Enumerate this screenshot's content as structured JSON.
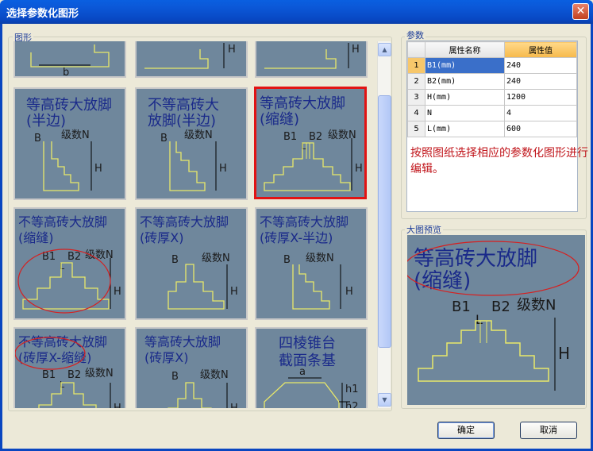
{
  "window": {
    "title": "选择参数化图形",
    "close_glyph": "✕"
  },
  "groups": {
    "shapes": "图形",
    "params": "参数",
    "preview": "大图预览"
  },
  "thumbnails": [
    {
      "line1": "",
      "line2": "",
      "labels": [
        "b"
      ]
    },
    {
      "line1": "",
      "line2": "",
      "labels": [
        "H"
      ]
    },
    {
      "line1": "",
      "line2": "",
      "labels": [
        "H"
      ]
    },
    {
      "line1": "等高砖大放脚",
      "line2": "(半边)",
      "labels": [
        "B",
        "级数N",
        "H"
      ]
    },
    {
      "line1": "不等高砖大",
      "line2": "放脚(半边)",
      "labels": [
        "B",
        "级数N",
        "H"
      ]
    },
    {
      "line1": "等高砖大放脚",
      "line2": "(缩缝)",
      "labels": [
        "B1",
        "B2",
        "级数N",
        "L",
        "H"
      ]
    },
    {
      "line1": "不等高砖大放脚",
      "line2": "(缩缝)",
      "labels": [
        "B1",
        "B2",
        "级数N",
        "L",
        "H"
      ]
    },
    {
      "line1": "不等高砖大放脚",
      "line2": "(砖厚X)",
      "labels": [
        "B",
        "级数N",
        "H"
      ]
    },
    {
      "line1": "不等高砖大放脚",
      "line2": "(砖厚X-半边)",
      "labels": [
        "B",
        "级数N",
        "H"
      ]
    },
    {
      "line1": "不等高砖大放脚",
      "line2": "(砖厚X-缩缝)",
      "labels": [
        "B1",
        "B2",
        "级数N",
        "L",
        "H"
      ]
    },
    {
      "line1": "等高砖大放脚",
      "line2": "(砖厚X)",
      "labels": [
        "B",
        "级数N",
        "H"
      ]
    },
    {
      "line1": "四棱锥台",
      "line2": "截面条基",
      "labels": [
        "a",
        "h1",
        "h2"
      ]
    }
  ],
  "params": {
    "headers": [
      "属性名称",
      "属性值"
    ],
    "rows": [
      {
        "idx": "1",
        "name": "B1(mm)",
        "value": "240"
      },
      {
        "idx": "2",
        "name": "B2(mm)",
        "value": "240"
      },
      {
        "idx": "3",
        "name": "H(mm)",
        "value": "1200"
      },
      {
        "idx": "4",
        "name": "N",
        "value": "4"
      },
      {
        "idx": "5",
        "name": "L(mm)",
        "value": "600"
      }
    ],
    "hint": "按照图纸选择相应的参数化图形进行编辑。"
  },
  "preview": {
    "line1": "等高砖大放脚",
    "line2": "(缩缝)",
    "labels": [
      "B1",
      "L",
      "B2",
      "级数N",
      "H"
    ]
  },
  "buttons": {
    "ok": "确定",
    "cancel": "取消"
  },
  "colors": {
    "thumb_bg": "#6f879c",
    "outline": "#e8e86a",
    "text": "#1a2a8a",
    "selected": "#e21313",
    "annotation": "#d62020"
  }
}
